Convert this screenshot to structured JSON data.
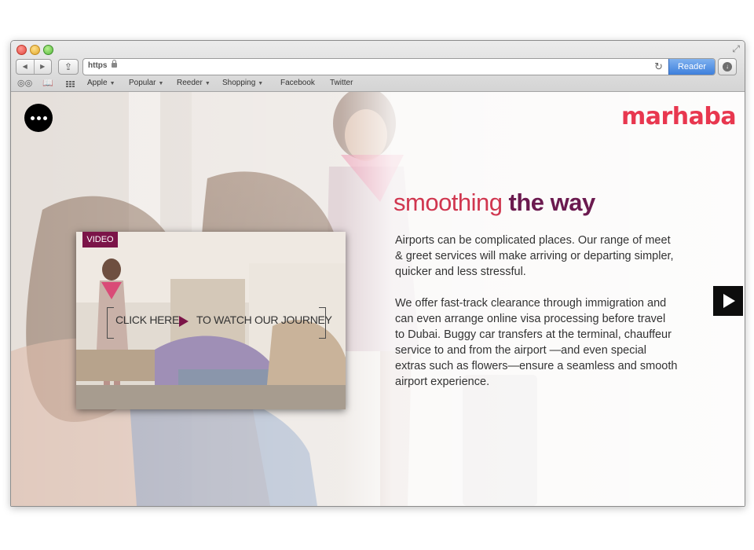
{
  "browser": {
    "url_scheme": "https",
    "reader_label": "Reader",
    "bookmarks": [
      {
        "label": "Apple",
        "menu": true
      },
      {
        "label": "Popular",
        "menu": true
      },
      {
        "label": "Reeder",
        "menu": true
      },
      {
        "label": "Shopping",
        "menu": true
      },
      {
        "label": "Facebook",
        "menu": false
      },
      {
        "label": "Twitter",
        "menu": false
      }
    ],
    "icons": [
      "back-icon",
      "forward-icon",
      "share-icon",
      "lock-icon",
      "reload-icon",
      "downloads-icon",
      "reading-list-icon",
      "bookmarks-icon",
      "top-sites-icon",
      "fullscreen-icon"
    ]
  },
  "page": {
    "logo": "marhaba",
    "headline_light": "smoothing",
    "headline_bold": "the way",
    "paragraph_1": "Airports can be complicated places. Our range of meet & greet services will make arriving or departing simpler, quicker and less stressful.",
    "paragraph_2": "We offer fast-track clearance through immigration and can even arrange online visa processing before travel to Dubai. Buggy car transfers at the terminal, chauffeur service to and from the airport —and even special extras such as flowers—ensure a seamless and smooth airport experience.",
    "video": {
      "tag": "VIDEO",
      "cta_left": "CLICK HERE",
      "cta_right": "TO WATCH OUR JOURNEY"
    }
  },
  "colors": {
    "logo": "#e8374f",
    "headline_light": "#d0364f",
    "headline_bold": "#6b1a4f",
    "video_tag": "#7b1448",
    "reader_button": "#4a88e0"
  }
}
